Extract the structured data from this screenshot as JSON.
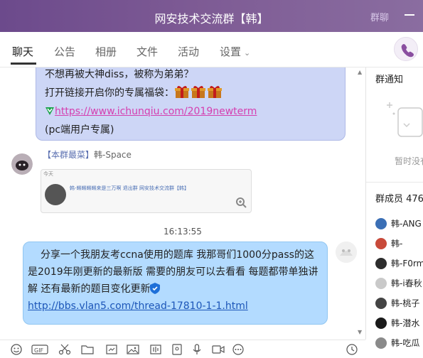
{
  "window": {
    "title": "网安技术交流群【韩】",
    "extra_label": "群聊"
  },
  "tabs": [
    {
      "label": "聊天"
    },
    {
      "label": "公告"
    },
    {
      "label": "相册"
    },
    {
      "label": "文件"
    },
    {
      "label": "活动"
    },
    {
      "label": "设置"
    }
  ],
  "messages": {
    "bubble1": {
      "line1": "不想再被大神diss，被称为弟弟？",
      "line2": "打开链接开启你的专属福袋：",
      "link": "https://www.ichunqiu.com/2019newterm",
      "line4": "(pc端用户专属)"
    },
    "sender": {
      "badge": "【本群最菜】",
      "name": "韩-Space"
    },
    "image_card": {
      "text": "韩-蝌蝌蝌蝌来是三万啊  退出群  网安技术交流群【韩】",
      "corner": "今天"
    },
    "timestamp": "16:13:55",
    "bubble2": {
      "text": "分享一个我朋友考ccna使用的题库 我那哥们1000分pass的这是2019年刚更新的最新版 需要的朋友可以去看看 每题都带单独讲解 还有最新的题目变化更新",
      "link": "http://bbs.vlan5.com/thread-17810-1-1.html"
    }
  },
  "right_panel": {
    "notice_title": "群通知",
    "notice_empty": "暂时没有",
    "members_title": "群成员 476",
    "members": [
      {
        "name": "韩-ANG"
      },
      {
        "name": "韩-"
      },
      {
        "name": "韩-F0rm"
      },
      {
        "name": "韩-i春秋"
      },
      {
        "name": "韩-桃子"
      },
      {
        "name": "韩-潜水"
      },
      {
        "name": "韩-吃瓜"
      }
    ]
  },
  "colors": {
    "titlebar": "#7d5a94",
    "bubble_sender": "#cdd6f6",
    "bubble_self": "#b3dbff",
    "link_pink": "#d53fb0",
    "link_blue": "#1c56b8"
  }
}
